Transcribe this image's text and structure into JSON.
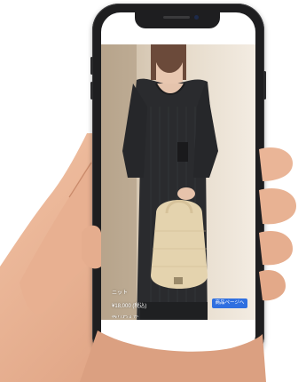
{
  "product": {
    "name": "ニット",
    "price": "¥18,000 (税込)",
    "extra_line": "残りわずか",
    "button_label": "商品ページへ"
  },
  "colors": {
    "phone_body": "#1e1e20",
    "skin": "#e9b495",
    "dress": "#2a2b2e",
    "button": "#2f6fe0"
  }
}
